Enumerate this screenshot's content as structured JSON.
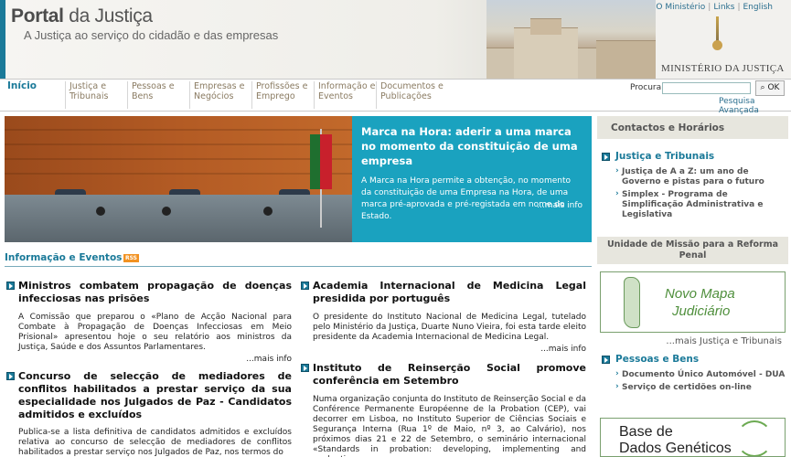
{
  "header": {
    "title_bold": "Portal",
    "title_rest": " da Justiça",
    "subtitle": "A Justiça ao serviço do cidadão e das empresas",
    "ministry": "MINISTÉRIO DA JUSTIÇA",
    "top_links": [
      "O Ministério",
      "Links",
      "English"
    ]
  },
  "nav": {
    "items": [
      {
        "label": "Início",
        "active": true
      },
      {
        "label": "Justiça e Tribunais"
      },
      {
        "label": "Pessoas e Bens"
      },
      {
        "label": "Empresas e Negócios"
      },
      {
        "label": "Profissões e Emprego"
      },
      {
        "label": "Informação e Eventos"
      },
      {
        "label": "Documentos e Publicações"
      }
    ],
    "search_label": "Procura",
    "search_value": "",
    "search_button": "OK",
    "advanced": "Pesquisa Avançada"
  },
  "hero": {
    "title": "Marca na Hora: aderir a uma marca no momento da constituição de uma empresa",
    "text": "A Marca na Hora permite a obtenção, no momento da constituição de uma Empresa na Hora, de uma marca pré-aprovada e pré-registada em nome do Estado.",
    "more": "...mais info"
  },
  "info_events": {
    "heading": "Informação e Eventos",
    "rss": "RSS",
    "news": [
      {
        "title": "Ministros combatem propagação de doenças infecciosas nas prisões",
        "text": "A Comissão que preparou o «Plano de Acção Nacional para Combate à Propagação de Doenças Infecciosas em Meio Prisional» apresentou hoje o seu relatório aos ministros da Justiça, Saúde e dos Assuntos Parlamentares.",
        "more": "...mais info"
      },
      {
        "title": "Academia Internacional de Medicina Legal presidida por português",
        "text": "O presidente do Instituto Nacional de Medicina Legal, tutelado pelo Ministério da Justiça, Duarte Nuno Vieira, foi esta tarde eleito presidente da Academia Internacional de Medicina Legal.",
        "more": "...mais info"
      },
      {
        "title": "Concurso de selecção de mediadores de conflitos habilitados a prestar serviço da sua especialidade nos Julgados de Paz - Candidatos admitidos e excluídos",
        "text": "Publica-se a lista definitiva de candidatos admitidos e excluídos relativa ao concurso de selecção de mediadores de conflitos habilitados a prestar serviço nos Julgados de Paz, nos termos do"
      },
      {
        "title": "Instituto de Reinserção Social promove conferência em Setembro",
        "text": "Numa organização conjunta do Instituto de Reinserção Social e da Conférence Permanente Européenne de la Probation (CEP), vai decorrer em Lisboa, no Instituto Superior de Ciências Sociais e Segurança Interna (Rua 1º de Maio, nº 3, ao Calvário), nos próximos dias 21 e 22 de Setembro, o seminário internacional «Standards in probation: developing, implementing and evaluating»."
      }
    ]
  },
  "right": {
    "contacts": "Contactos e Horários",
    "justica": {
      "title": "Justiça e Tribunais",
      "items": [
        "Justiça de A a Z: um ano de Governo e pistas para o futuro",
        "Simplex - Programa de Simplificação Administrativa e Legislativa"
      ]
    },
    "umrp": "Unidade de Missão para a Reforma Penal",
    "mapa_line1": "Novo Mapa",
    "mapa_line2": "Judiciário",
    "more_justica": "...mais Justiça e Tribunais",
    "pessoas": {
      "title": "Pessoas e Bens",
      "items": [
        "Documento Único Automóvel - DUA",
        "Serviço de certidões on-line"
      ]
    },
    "bdg_line1": "Base de",
    "bdg_line2": "Dados Genéticos"
  },
  "colors": {
    "accent": "#1b7a99",
    "hero_box": "#1aa2bf",
    "nav_text": "#8a7b62"
  }
}
